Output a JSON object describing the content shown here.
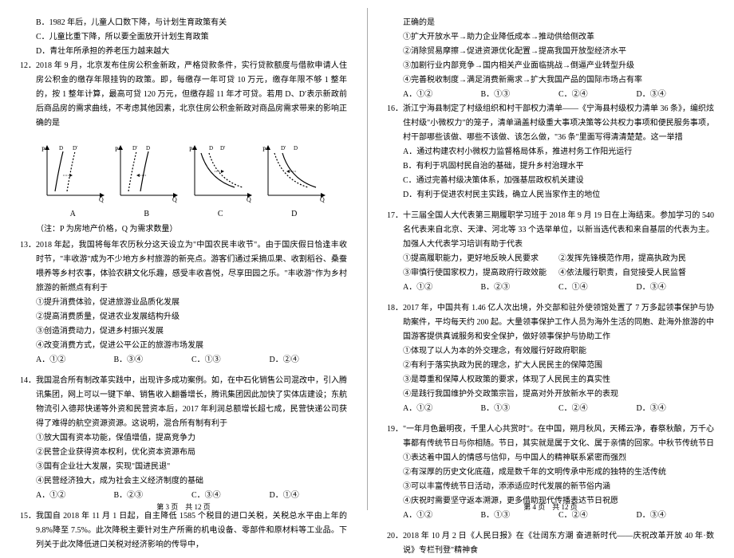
{
  "page_left": {
    "q11_options": {
      "b": "B．1982 年后，儿童人口数下降，与计划生育政策有关",
      "c": "C．儿童比重下降，所以要全面放开计划生育政策",
      "d": "D．青壮年所承担的养老压力越来越大"
    },
    "q12": {
      "num": "12．",
      "text": "2018 年 9 月，北京发布住房公积金新政，严格贷款条件，实行贷款额度与借款申请人住房公积金的缴存年限挂钩的政策。即，每缴存一年可贷 10 万元，缴存年限不够 1 整年的，按 1 整年计算，最高可贷 120 万元，但缴存超 11 年才可贷。若用 D、D′表示新政前后商品房的需求曲线，不考虑其他因素，北京住房公积金新政对商品房需求带来的影响正确的是"
    },
    "chart_data": [
      {
        "type": "line",
        "label": "A",
        "desc": "P-Q axes, D D′ curves shifting right, both upward"
      },
      {
        "type": "line",
        "label": "B",
        "desc": "P-Q axes, D′ D curves, dashed left of solid"
      },
      {
        "type": "line",
        "label": "C",
        "desc": "P-Q axes, D D′ downward curves"
      },
      {
        "type": "line",
        "label": "D",
        "desc": "P-Q axes, D′ D downward, dashed left"
      }
    ],
    "chart_note": "（注：P 为房地产价格，Q 为需求数量）",
    "q13": {
      "num": "13．",
      "text": "2018 年起，我国将每年农历秋分这天设立为\"中国农民丰收节\"。由于国庆假日恰逢丰收时节，\"丰收游\"成为不少地方乡村旅游的新亮点。游客们通过采摘瓜果、收割稻谷、桑蚕喂养等乡村农事，体验农耕文化乐趣，感受丰收喜悦，尽享田园之乐。\"丰收游\"作为乡村旅游的新燃点有利于",
      "opts": [
        "①提升消费体验，促进旅游业品质化发展",
        "②提高消费质量，促进农业发展结构升级",
        "③创造消费动力，促进乡村振兴发展",
        "④改变消费方式，促进公平公正的旅游市场发展"
      ],
      "choices": [
        "A．①②",
        "B．③④",
        "C．①③",
        "D．②④"
      ]
    },
    "q14": {
      "num": "14．",
      "text": "我国混合所有制改革实践中，出现许多成功案例。如，在中石化销售公司混改中，引入腾讯集团，网上可以一键下单、销售收入翻番增长，腾讯集团因此加快了实体店建设；东航物流引入德邦快递等外资和民营资本后，2017 年利润总额增长超七成，民营快递公司获得了难得的航空资源资源。这说明，混合所有制有利于",
      "opts": [
        "①放大国有资本功能，保值增值，提高竞争力",
        "②民营企业获得资本权利，优化资本资源布局",
        "③国有企业壮大发展，实现\"国进民退\"",
        "④民营经济独大，成为社会主义经济制度的基础"
      ],
      "choices": [
        "A．①②",
        "B．②③",
        "C．③④",
        "D．①④"
      ]
    },
    "q15": {
      "num": "15．",
      "text": "我国自 2018 年 11 月 1 日起，自主降低 1585 个税目的进口关税，关税总水平由上年的 9.8%降至 7.5%。此次降税主要针对生产所需的机电设备、零部件和原材料等工业品。下列关于此次降低进口关税对经济影响的传导中，"
    },
    "footer": "第 3 页　共 12 页"
  },
  "page_right": {
    "q15_cont": {
      "header": "正确的是",
      "opts": [
        "①扩大开放水平→助力企业降低成本→推动供给侧改革",
        "②消除贸易摩擦→促进资源优化配置→提高我国开放型经济水平",
        "③加剧行业内部竞争→国内相关产业面临挑战→倒逼产业转型升级",
        "④完善税收制度→满足消费新需求→扩大我国产品的国际市场占有率"
      ],
      "choices": [
        "A．①②",
        "B．①③",
        "C．②④",
        "D．③④"
      ]
    },
    "q16": {
      "num": "16．",
      "text": "浙江宁海县制定了村级组织和村干部权力清单——《宁海县村级权力清单 36 条》，编织炫住村级\"小微权力\"的笼子，清单涵盖村级重大事项决策等公共权力事项和便民服务事项，村干部哪些该做、哪些不该做、该怎么做，\"36 条\"里面写得清清楚楚。这一举措",
      "opts": [
        "A．通过构建农村小微权力监督格局体系，推进村务工作阳光运行",
        "B．有利于巩固村民自治的基础，提升乡村治理水平",
        "C．通过完善村级决策体系，加强基层政权机关建设",
        "D．有利于促进农村民主实践，确立人民当家作主的地位"
      ]
    },
    "q17": {
      "num": "17．",
      "text": "十三届全国人大代表第三期履职学习班于 2018 年 9 月 19 日在上海结束。参加学习的 540 名代表来自北京、天津、河北等 33 个选举单位，以新当选代表和来自基层的代表为主。加强人大代表学习培训有助于代表",
      "opts": [
        "①提高履职能力，更好地反映人民要求",
        "②发挥先锋模范作用，提高执政为民",
        "③审慎行使国家权力，提高政府行政效能",
        "④依法履行职责，自觉接受人民监督"
      ],
      "choices": [
        "A．①②",
        "B．②③",
        "C．①④",
        "D．③④"
      ]
    },
    "q18": {
      "num": "18．",
      "text": "2017 年，中国共有 1.46 亿人次出境，外交部和驻外使领馆处置了 7 万多起领事保护与协助案件，平均每天约 200 起。大量领事保护工作人员为海外生活的同胞、赴海外旅游的中国游客提供真诚服务和安全保护，做好领事保护与协助工作",
      "opts": [
        "①体现了以人为本的外交理念，有效履行好政府职能",
        "②有利于落实执政为民的理念，扩大人民民主的保障范围",
        "③是尊重和保障人权政策的要求，体现了人民民主的真实性",
        "④是践行我国维护外交政策宗旨，提高对外开放新水平的表现"
      ],
      "choices": [
        "A．①②",
        "B．①③",
        "C．②④",
        "D．③④"
      ]
    },
    "q19": {
      "num": "19．",
      "text": "\"一年月色最明夜，千里人心共赏时\"。在中国，朔月秋风，天稀云净，春祭秋酿，万千心事都有传统节日与你相随。节日，其实就是属于文化、属于亲情的回家。中秋节传统节日",
      "opts": [
        "①表达着中国人的情感与信仰，与中国人的精神联系紧密而强烈",
        "②有深厚的历史文化底蕴，成是数千年的文明传承中形成的独特的生活传统",
        "③可以丰富传统节日活动，添添适应时代发展的新节俗内涵",
        "④庆祝时需要坚守返本溯源，更多借助现代传播表达节日祝愿"
      ],
      "choices": [
        "A．①②",
        "B．①③",
        "C．②④",
        "D．③④"
      ]
    },
    "q20": {
      "num": "20．",
      "text": "2018 年 10 月 2 日《人民日报》在《壮阔东方潮 奋进新时代——庆祝改革开放 40 年·数说》专栏刊登\"精神食"
    },
    "footer": "第 4 页　共 12 页"
  }
}
